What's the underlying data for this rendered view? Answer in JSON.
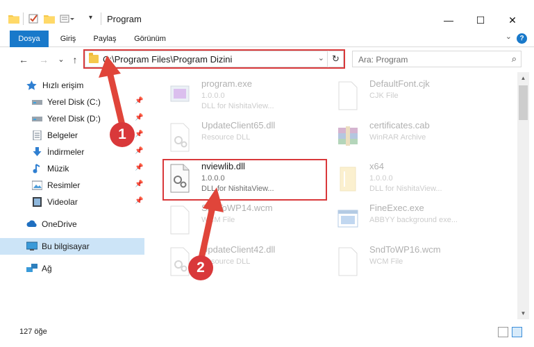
{
  "window": {
    "title": "Program",
    "minimize_glyph": "—",
    "maximize_glyph": "☐",
    "close_glyph": "✕"
  },
  "ribbon": {
    "tabs": [
      {
        "label": "Dosya"
      },
      {
        "label": "Giriş"
      },
      {
        "label": "Paylaş"
      },
      {
        "label": "Görünüm"
      }
    ],
    "expand_glyph": "⌄",
    "help_glyph": "?"
  },
  "navigation": {
    "back_glyph": "←",
    "forward_glyph": "→",
    "recent_glyph": "⌄",
    "up_glyph": "↑",
    "address": "C:\\Program Files\\Program Dizini",
    "dropdown_glyph": "⌄",
    "refresh_glyph": "↻",
    "search_placeholder": "Ara: Program",
    "search_glyph": "⌕"
  },
  "sidebar": {
    "items": [
      {
        "label": "Hızlı erişim",
        "icon": "star-icon"
      },
      {
        "label": "Yerel Disk (C:)",
        "icon": "drive-icon",
        "pinned": true
      },
      {
        "label": "Yerel Disk (D:)",
        "icon": "drive-icon",
        "pinned": true
      },
      {
        "label": "Belgeler",
        "icon": "documents-icon",
        "pinned": true
      },
      {
        "label": "İndirmeler",
        "icon": "download-icon",
        "pinned": true
      },
      {
        "label": "Müzik",
        "icon": "music-icon",
        "pinned": true
      },
      {
        "label": "Resimler",
        "icon": "pictures-icon",
        "pinned": true
      },
      {
        "label": "Videolar",
        "icon": "videos-icon",
        "pinned": true
      },
      {
        "label": "OneDrive",
        "icon": "cloud-icon"
      },
      {
        "label": "Bu bilgisayar",
        "icon": "computer-icon",
        "selected": true
      },
      {
        "label": "Ağ",
        "icon": "network-icon"
      }
    ],
    "pin_glyph": "📌"
  },
  "files": [
    {
      "name": "program.exe",
      "line2": "1.0.0.0",
      "line3": "DLL for NishitaView...",
      "icon": "exe-icon",
      "faded": true
    },
    {
      "name": "DefaultFont.cjk",
      "line2": "CJK File",
      "line3": "",
      "icon": "blank-file-icon",
      "faded": true
    },
    {
      "name": "UpdateClient65.dll",
      "line2": "Resource DLL",
      "line3": "",
      "icon": "dll-file-icon",
      "faded": true
    },
    {
      "name": "certificates.cab",
      "line2": "WinRAR Archive",
      "line3": "",
      "icon": "archive-icon",
      "faded": true
    },
    {
      "name": "nviewlib.dll",
      "line2": "1.0.0.0",
      "line3": "DLL for NishitaView...",
      "icon": "dll-file-icon",
      "faded": false
    },
    {
      "name": "x64",
      "line2": "1.0.0.0",
      "line3": "DLL for NishitaView...",
      "icon": "folder-file-icon",
      "faded": true
    },
    {
      "name": "SndToWP14.wcm",
      "line2": "WCM File",
      "line3": "",
      "icon": "blank-file-icon",
      "faded": true
    },
    {
      "name": "FineExec.exe",
      "line2": "ABBYY background exe...",
      "line3": "",
      "icon": "app-window-icon",
      "faded": true
    },
    {
      "name": "UpdateClient42.dll",
      "line2": "Resource DLL",
      "line3": "",
      "icon": "dll-file-icon",
      "faded": true
    },
    {
      "name": "SndToWP16.wcm",
      "line2": "WCM File",
      "line3": "",
      "icon": "blank-file-icon",
      "faded": true
    }
  ],
  "status": {
    "item_count": "127 öğe"
  },
  "callouts": [
    "1",
    "2"
  ],
  "colors": {
    "accent": "#1979ca",
    "highlight": "#d9383a",
    "selection": "#cce4f7"
  }
}
